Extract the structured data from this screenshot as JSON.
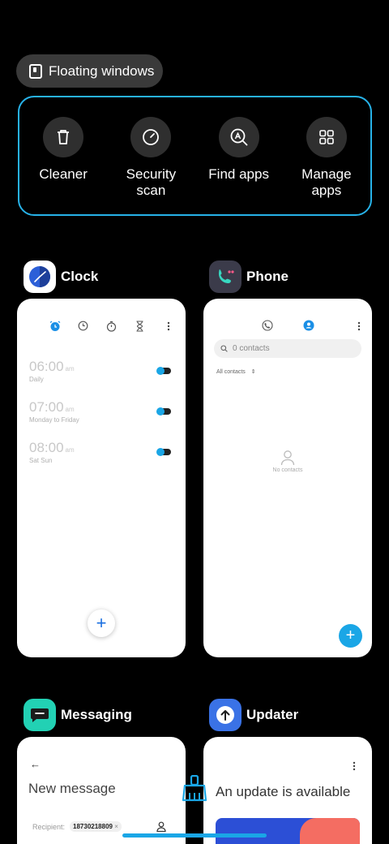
{
  "floating": {
    "label": "Floating windows",
    "icon": "floating-window-icon"
  },
  "tools": [
    {
      "label": "Cleaner",
      "icon": "trash-icon"
    },
    {
      "label": "Security scan",
      "icon": "speedometer-icon"
    },
    {
      "label": "Find apps",
      "icon": "find-apps-icon"
    },
    {
      "label": "Manage apps",
      "icon": "grid-icon"
    }
  ],
  "apps": {
    "clock": {
      "name": "Clock",
      "alarms": [
        {
          "time": "06:00",
          "ampm": "am",
          "repeat": "Daily"
        },
        {
          "time": "07:00",
          "ampm": "am",
          "repeat": "Monday to Friday"
        },
        {
          "time": "08:00",
          "ampm": "am",
          "repeat": "Sat Sun"
        }
      ],
      "fab": "+"
    },
    "phone": {
      "name": "Phone",
      "search_placeholder": "0 contacts",
      "filter": "All contacts",
      "empty": "No contacts",
      "fab": "+"
    },
    "messaging": {
      "name": "Messaging",
      "back": "←",
      "title": "New message",
      "recipient_label": "Recipient:",
      "recipient": "18730218809",
      "chip_close": "×"
    },
    "updater": {
      "name": "Updater",
      "title": "An update is available"
    }
  },
  "colors": {
    "accent": "#27b2e8",
    "toggle": "#1aa6e6",
    "background": "#000000"
  }
}
